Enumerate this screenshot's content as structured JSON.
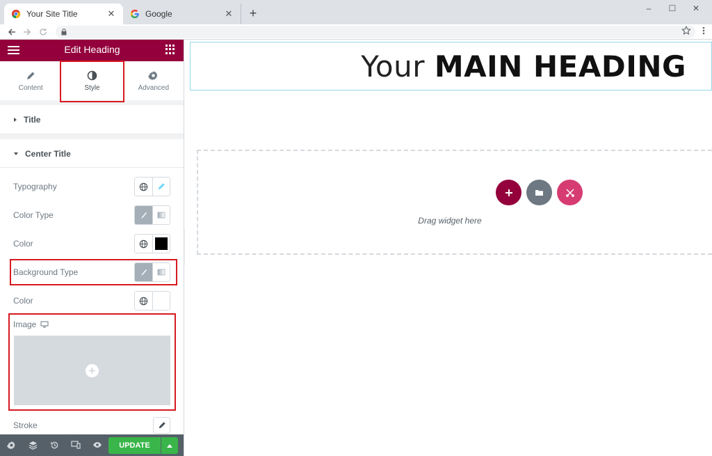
{
  "browser": {
    "tabs": [
      {
        "title": "Your Site Title",
        "active": true
      },
      {
        "title": "Google",
        "active": false
      }
    ],
    "new_tab": "+",
    "window_controls": [
      "–",
      "☐",
      "✕"
    ],
    "close_glyph": "✕"
  },
  "panel": {
    "header_title": "Edit Heading",
    "tabs": [
      {
        "label": "Content",
        "icon": "pencil-icon"
      },
      {
        "label": "Style",
        "icon": "contrast-icon"
      },
      {
        "label": "Advanced",
        "icon": "gear-icon"
      }
    ],
    "sections": {
      "title": "Title",
      "center_title": "Center Title"
    },
    "controls": {
      "typography": "Typography",
      "color_type": "Color Type",
      "color": "Color",
      "background_type": "Background Type",
      "bg_color": "Color",
      "image": "Image",
      "stroke": "Stroke"
    },
    "footer": {
      "update_label": "UPDATE"
    }
  },
  "canvas": {
    "heading_light": "Your",
    "heading_bold": "MAIN HEADING",
    "drop_text": "Drag widget here"
  },
  "colors": {
    "brand": "#93003c",
    "update_green": "#39b54a",
    "highlight_red": "#d71920",
    "add_button": "#93003c",
    "folder_button": "#6d7882",
    "pro_button": "#d63c72"
  }
}
